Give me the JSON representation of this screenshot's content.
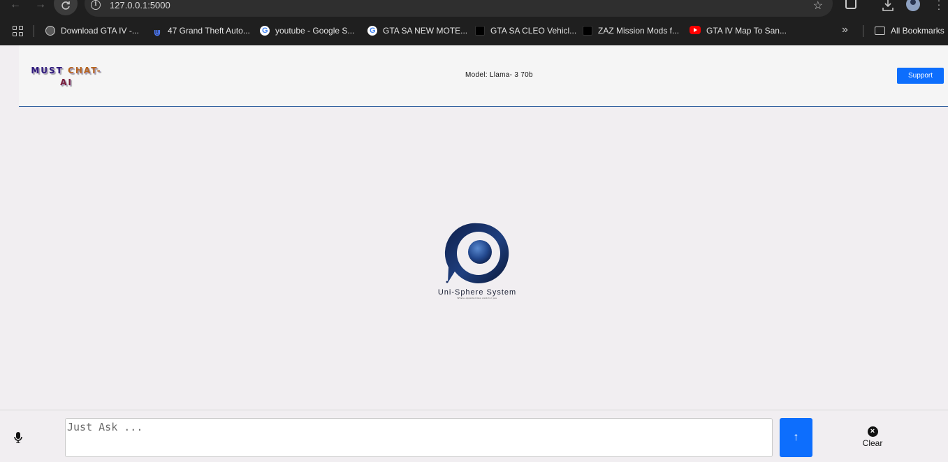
{
  "browser": {
    "url": "127.0.0.1:5000",
    "bookmarks": [
      {
        "label": "Download GTA IV -...",
        "icon": "globe-icon"
      },
      {
        "label": "47 Grand Theft Auto...",
        "icon": "site-favicon-icon"
      },
      {
        "label": "youtube - Google S...",
        "icon": "google-icon"
      },
      {
        "label": "GTA SA NEW MOTE...",
        "icon": "google-icon"
      },
      {
        "label": "GTA SA CLEO Vehicl...",
        "icon": "black-square-favicon-icon"
      },
      {
        "label": "ZAZ Mission Mods f...",
        "icon": "black-square-favicon-icon"
      },
      {
        "label": "GTA IV Map To San...",
        "icon": "youtube-icon"
      }
    ],
    "all_bookmarks_label": "All Bookmarks"
  },
  "header": {
    "logo_line1_a": "MUST",
    "logo_line1_b": "CHAT-",
    "logo_line2": "AI",
    "model_label": "Model: Llama- 3 70b",
    "support_label": "Support"
  },
  "brand": {
    "name": "Uni-Sphere System",
    "tagline": "Where opportunities work for you"
  },
  "input": {
    "placeholder": "Just Ask ...",
    "value": "",
    "send_label": "↑",
    "clear_label": "Clear"
  },
  "colors": {
    "accent": "#0d6efd",
    "header_divider": "#2f5f9e",
    "page_background": "#f1eef1",
    "logo_blue": "#2d1a7a",
    "logo_orange": "#b6651e"
  }
}
